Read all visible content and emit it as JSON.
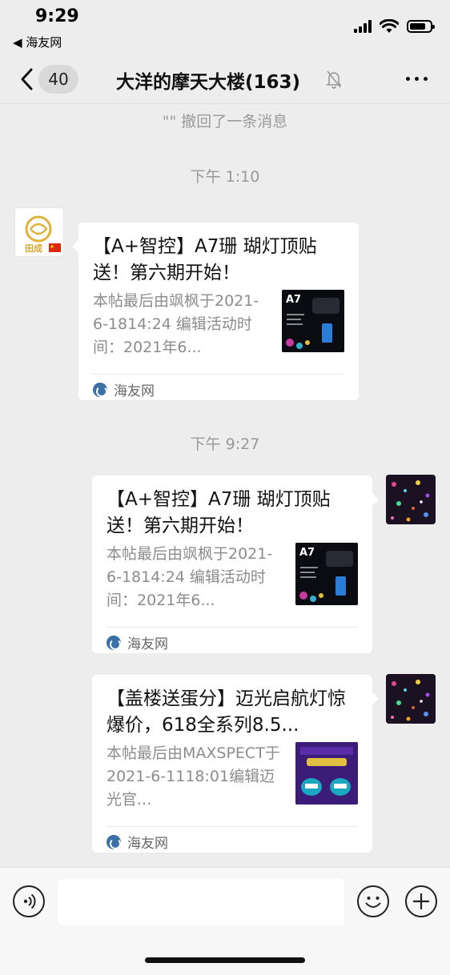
{
  "status_bar": {
    "time": "9:29",
    "back_app": "◀ 海友网",
    "battery_level": 0.8,
    "icons": [
      "signal-icon",
      "wifi-icon",
      "battery-icon"
    ]
  },
  "nav": {
    "unread_count": "40",
    "title": "大洋的摩天大楼(163)",
    "icons": [
      "back-arrow-icon",
      "mute-bell-icon",
      "more-icon"
    ]
  },
  "messages": {
    "recall_notice": "\"\" 撤回了一条消息",
    "timestamp_1": "下午 1:10",
    "timestamp_2": "下午 9:27",
    "card_1": {
      "title": "【A+智控】A7珊 瑚灯顶贴送！第六期开始！",
      "description": "本帖最后由飒枫于2021-6-1814:24 编辑活动时间：2021年6...",
      "source": "海友网",
      "thumb_text": "A7"
    },
    "card_2": {
      "title": "【A+智控】A7珊 瑚灯顶贴送！第六期开始！",
      "description": "本帖最后由飒枫于2021-6-1814:24 编辑活动时间：2021年6...",
      "source": "海友网",
      "thumb_text": "A7"
    },
    "card_3": {
      "title": "【盖楼送蛋分】迈光启航灯惊爆价，618全系列8.5...",
      "description": "本帖最后由MAXSPECT于2021-6-1118:01编辑迈光官...",
      "source": "海友网"
    }
  },
  "colors": {
    "background": "#ededed",
    "card": "#ffffff",
    "muted_text": "#8c8c8c",
    "input_bar": "#f7f7f7"
  }
}
